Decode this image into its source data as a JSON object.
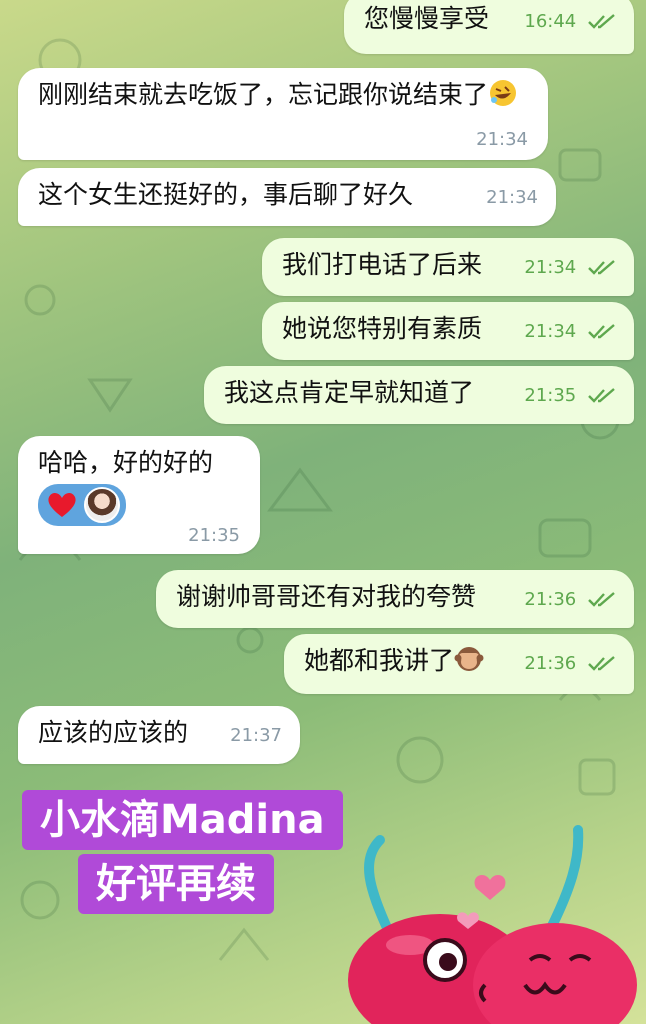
{
  "messages": [
    {
      "side": "out",
      "text": "您慢慢享受",
      "time": "16:44",
      "ticks": true
    },
    {
      "side": "in",
      "text": "刚刚结束就去吃饭了，忘记跟你说结束了",
      "emoji": "rofl",
      "time": "21:34"
    },
    {
      "side": "in",
      "text": "这个女生还挺好的，事后聊了好久",
      "time": "21:34"
    },
    {
      "side": "out",
      "text": "我们打电话了后来",
      "time": "21:34",
      "ticks": true
    },
    {
      "side": "out",
      "text": "她说您特别有素质",
      "time": "21:34",
      "ticks": true
    },
    {
      "side": "out",
      "text": "我这点肯定早就知道了",
      "time": "21:35",
      "ticks": true
    },
    {
      "side": "in",
      "text": "哈哈，好的好的",
      "time": "21:35",
      "reaction": "red-heart"
    },
    {
      "side": "out",
      "text": "谢谢帅哥哥还有对我的夸赞",
      "time": "21:36",
      "ticks": true
    },
    {
      "side": "out",
      "text": "她都和我讲了",
      "emoji": "see-no-evil-monkey",
      "time": "21:36",
      "ticks": true
    },
    {
      "side": "in",
      "text": "应该的应该的",
      "time": "21:37"
    }
  ],
  "overlay": {
    "line1": "小水滴Madina",
    "line2": "好评再续",
    "color": "#b04ad8"
  },
  "sticker": "kissing-cherries",
  "colors": {
    "incoming": "#ffffff",
    "outgoing": "#effdde",
    "outgoing_meta": "#5ea84e",
    "incoming_meta": "#8a9aa6"
  }
}
